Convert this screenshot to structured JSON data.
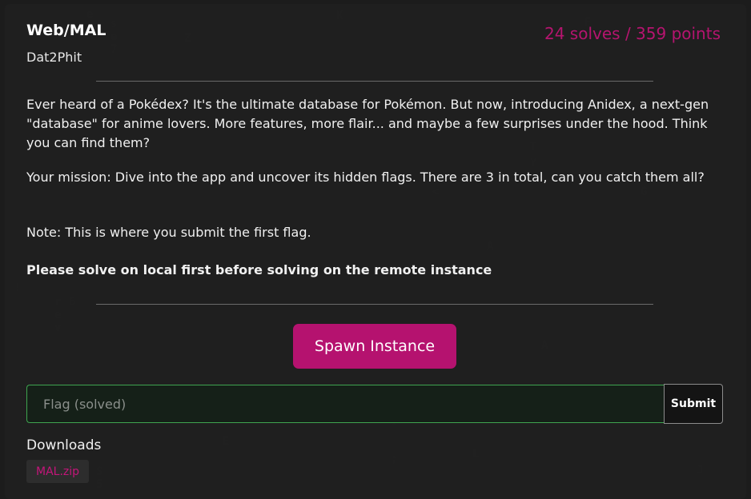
{
  "challenge": {
    "title": "Web/MAL",
    "author": "Dat2Phit",
    "stats": "24 solves / 359 points",
    "description": [
      "Ever heard of a Pokédex? It's the ultimate database for Pokémon. But now, introducing Anidex, a next-gen \"database\" for anime lovers. More features, more flair... and maybe a few surprises under the hood. Think you can find them?",
      "Your mission: Dive into the app and uncover its hidden flags. There are 3 in total, can you catch them all?",
      "Note: This is where you submit the first flag."
    ],
    "notice": "Please solve on local first before solving on the remote instance"
  },
  "actions": {
    "spawn_label": "Spawn Instance",
    "flag_placeholder": "Flag (solved)",
    "flag_value": "",
    "submit_label": "Submit"
  },
  "downloads": {
    "label": "Downloads",
    "files": [
      "MAL.zip"
    ]
  },
  "colors": {
    "accent": "#b5126f",
    "solved_border": "#3fa44f",
    "background": "#1c1c1c"
  }
}
